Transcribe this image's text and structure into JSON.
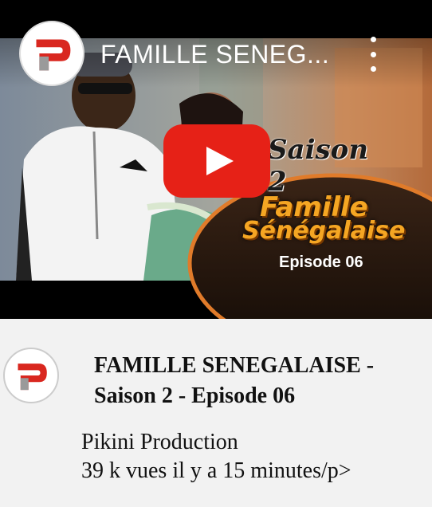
{
  "player": {
    "title": "FAMILLE SENEG...",
    "thumbnail": {
      "saison_text": "Saison 2",
      "show_line1": "Famille",
      "show_line2": "Sénégalaise",
      "episode_text": "Episode 06"
    },
    "icons": {
      "channel_logo": "pikini-logo-icon",
      "more": "more-vert-icon",
      "play": "youtube-play-icon"
    },
    "colors": {
      "play_red": "#e62117",
      "logo_red": "#d9271f",
      "accent_orange": "#f5a623"
    }
  },
  "info": {
    "title": "FAMILLE SENEGALAISE - Saison 2 - Episode 06",
    "channel": "Pikini Production",
    "meta": "39 k vues il y a 15 minutes/p>"
  }
}
